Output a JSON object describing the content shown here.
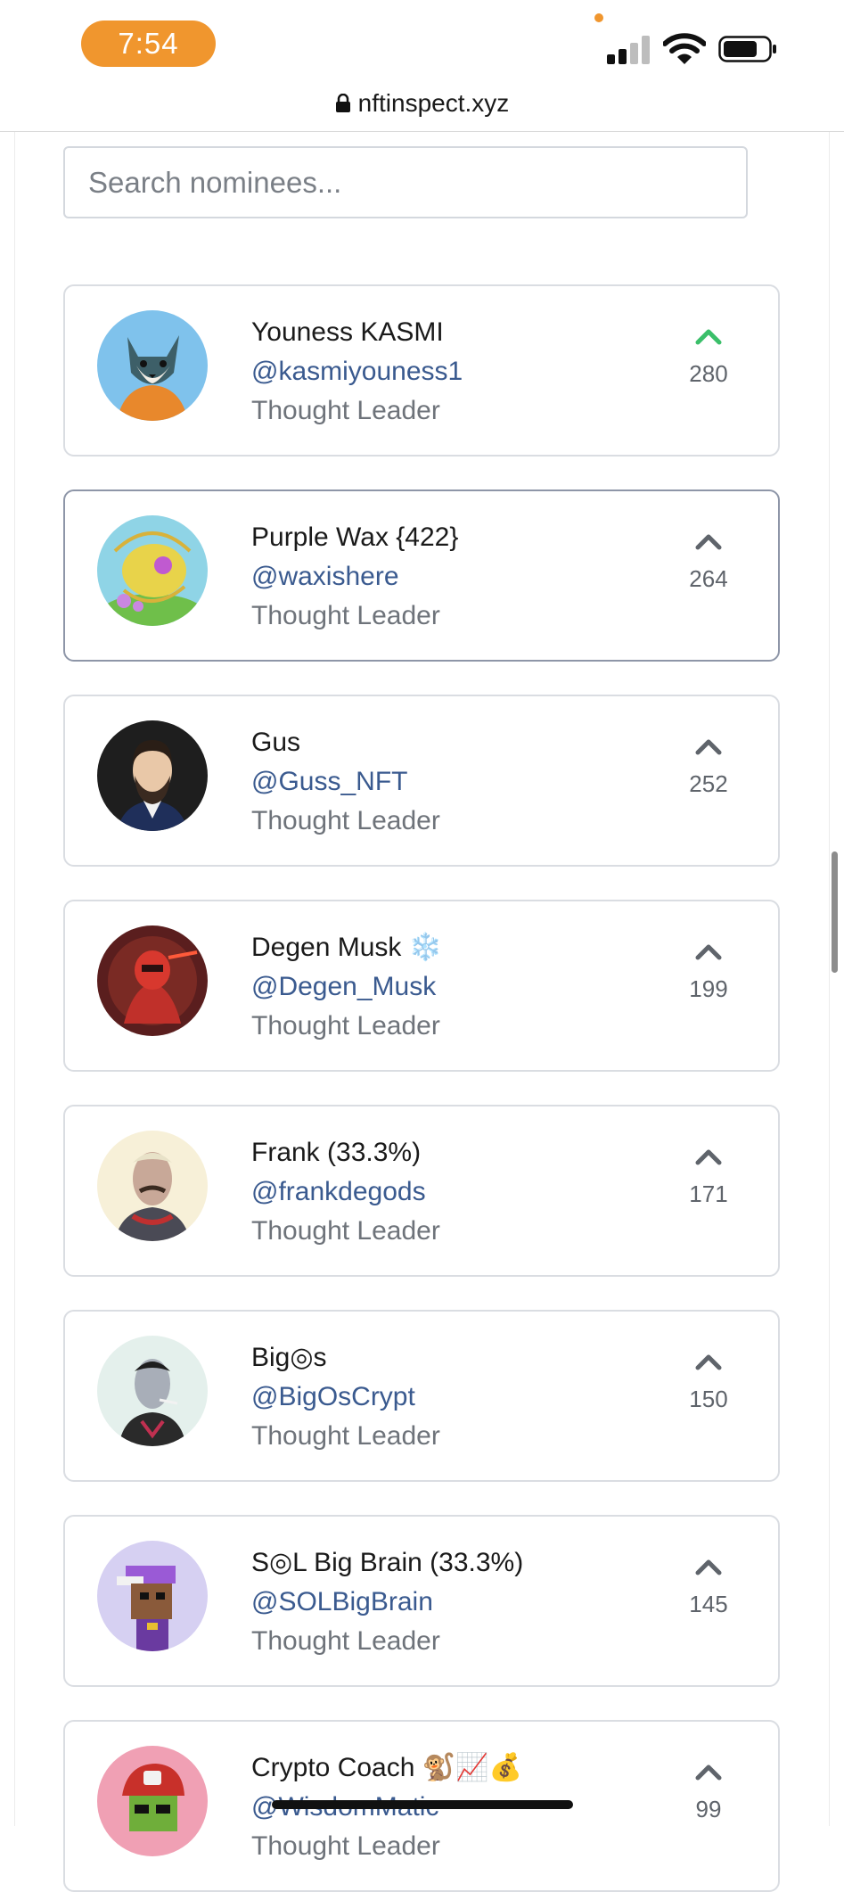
{
  "status_bar": {
    "time": "7:54"
  },
  "browser": {
    "url": "nftinspect.xyz"
  },
  "search": {
    "placeholder": "Search nominees..."
  },
  "colors": {
    "accent_orange": "#f0962e",
    "upvoted_green": "#3bbf6a",
    "handle_blue": "#3a5a8f"
  },
  "nominees": [
    {
      "name": "Youness KASMI",
      "handle": "@kasmiyouness1",
      "role": "Thought Leader",
      "votes": "280",
      "upvoted": true,
      "avatar": "fox-avatar"
    },
    {
      "name": "Purple Wax {422}",
      "handle": "@waxishere",
      "role": "Thought Leader",
      "votes": "264",
      "upvoted": false,
      "avatar": "yellow-creature-avatar"
    },
    {
      "name": "Gus",
      "handle": "@Guss_NFT",
      "role": "Thought Leader",
      "votes": "252",
      "upvoted": false,
      "avatar": "bearded-man-avatar"
    },
    {
      "name": "Degen Musk ❄️",
      "handle": "@Degen_Musk",
      "role": "Thought Leader",
      "votes": "199",
      "upvoted": false,
      "avatar": "red-robot-avatar"
    },
    {
      "name": "Frank (33.3%)",
      "handle": "@frankdegods",
      "role": "Thought Leader",
      "votes": "171",
      "upvoted": false,
      "avatar": "tattooed-man-avatar"
    },
    {
      "name": "Big◎s",
      "handle": "@BigOsCrypt",
      "role": "Thought Leader",
      "votes": "150",
      "upvoted": false,
      "avatar": "gray-man-avatar"
    },
    {
      "name": "S◎L Big Brain (33.3%)",
      "handle": "@SOLBigBrain",
      "role": "Thought Leader",
      "votes": "145",
      "upvoted": false,
      "avatar": "pixel-ape-avatar"
    },
    {
      "name": "Crypto Coach 🐒📈💰",
      "handle": "@WisdomMatic",
      "role": "Thought Leader",
      "votes": "99",
      "upvoted": false,
      "avatar": "red-cap-avatar"
    }
  ]
}
